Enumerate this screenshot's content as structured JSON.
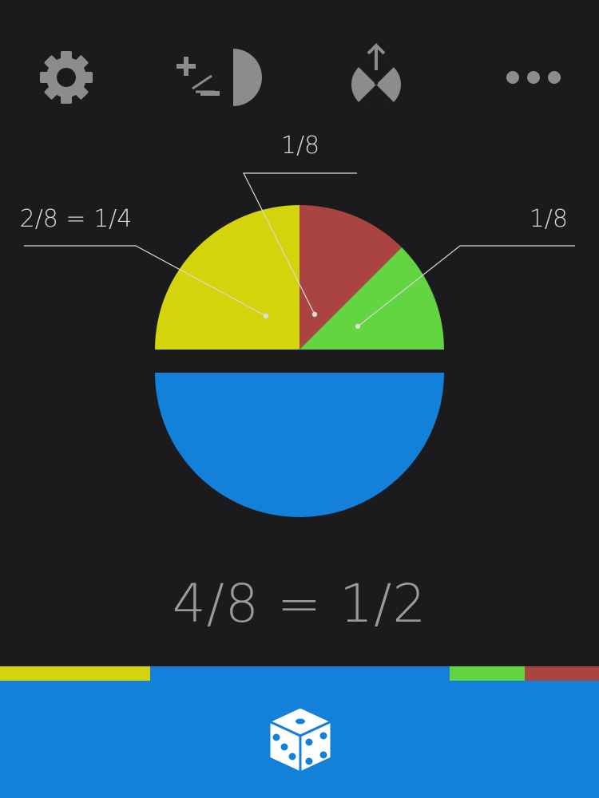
{
  "toolbar": {
    "icons": [
      "gear-icon",
      "plus-minus-pie-icon",
      "share-pie-icon",
      "more-dots-icon"
    ]
  },
  "chart_data": {
    "type": "pie",
    "unit": "eighths",
    "slices": [
      {
        "label": "2/8 = 1/4",
        "numerator": 2,
        "denominator": 8,
        "color": "#d4d40c"
      },
      {
        "label": "1/8",
        "numerator": 1,
        "denominator": 8,
        "color": "#aa4440"
      },
      {
        "label": "1/8",
        "numerator": 1,
        "denominator": 8,
        "color": "#62d540"
      },
      {
        "label": "",
        "numerator": 4,
        "denominator": 8,
        "color": "#1380da"
      }
    ]
  },
  "total": {
    "text": "4/8 = 1/2"
  },
  "colors": {
    "background": "#1b1b1d",
    "icon": "#8c8c8e",
    "label": "#d8d8d8",
    "yellow": "#d4d40c",
    "red": "#aa4440",
    "green": "#62d540",
    "blue": "#1380da"
  },
  "bottom_bar": {
    "dice_icon": "dice-icon",
    "strip_fractions": [
      {
        "color": "#d4d40c",
        "fraction": 0.25
      },
      {
        "color": "#1380da",
        "fraction": 0.5
      },
      {
        "color": "#62d540",
        "fraction": 0.125
      },
      {
        "color": "#aa4440",
        "fraction": 0.125
      }
    ]
  }
}
